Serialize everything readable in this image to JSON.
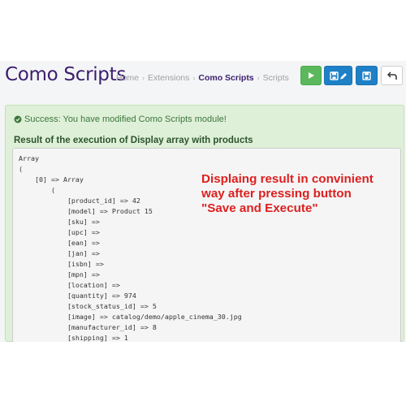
{
  "header": {
    "title": "Como Scripts",
    "breadcrumb": [
      "Home",
      "Extensions",
      "Como Scripts",
      "Scripts"
    ],
    "breadcrumb_separator": "›",
    "buttons": [
      {
        "icon": "play-icon",
        "color": "#5cb85c"
      },
      {
        "icon": "save-edit-icon",
        "color": "#1e80c6"
      },
      {
        "icon": "save-icon",
        "color": "#1e80c6"
      },
      {
        "icon": "back-arrow-icon",
        "color": "#ffffff"
      }
    ]
  },
  "alert": {
    "icon": "check-circle-icon",
    "message": "Success: You have modified Como Scripts module!",
    "color": "#dff0d8"
  },
  "result": {
    "title": "Result of the execution of Display array with products",
    "lines": [
      "Array",
      "(",
      "    [0] => Array",
      "        (",
      "            [product_id] => 42",
      "            [model] => Product 15",
      "            [sku] =>",
      "            [upc] =>",
      "            [ean] =>",
      "            [jan] =>",
      "            [isbn] =>",
      "            [mpn] =>",
      "            [location] =>",
      "            [quantity] => 974",
      "            [stock_status_id] => 5",
      "            [image] => catalog/demo/apple_cinema_30.jpg",
      "            [manufacturer_id] => 8",
      "            [shipping] => 1"
    ]
  },
  "annotation": {
    "lines": [
      "Displaing result in convinient",
      "way after pressing button",
      "\"Save and Execute\""
    ],
    "color": "#dd1f1f"
  }
}
